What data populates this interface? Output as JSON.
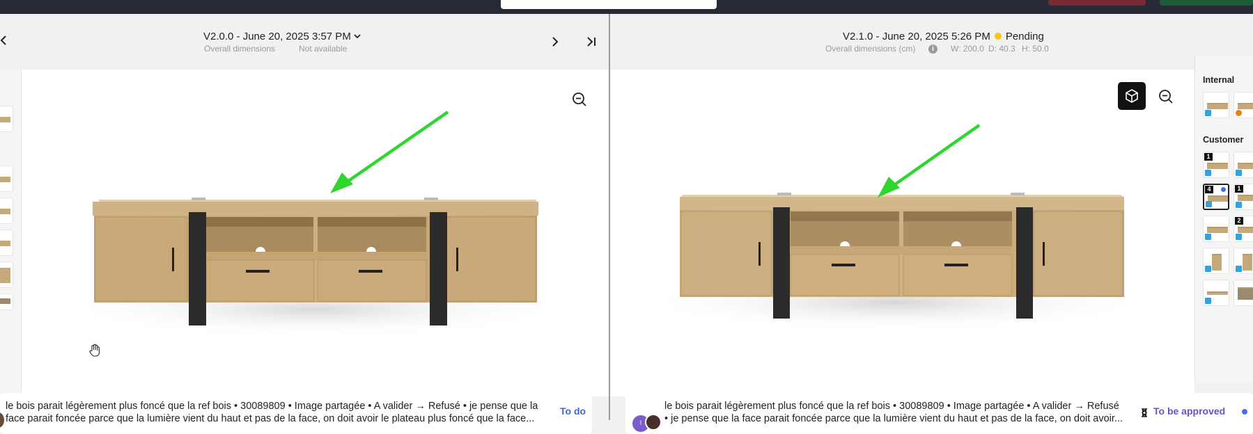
{
  "left_version": {
    "title": "V2.0.0 - June 20, 2025 3:57 PM",
    "dims_label": "Overall dimensions",
    "dims_value": "Not available"
  },
  "right_version": {
    "title": "V2.1.0 - June 20, 2025 5:26 PM",
    "status": "Pending",
    "status_color": "#f5c518",
    "dims_label": "Overall dimensions (cm)",
    "width": "W: 200.0",
    "depth": "D: 40.3",
    "height": "H: 50.0"
  },
  "sidebar": {
    "internal_label": "Internal",
    "customer_label": "Customer",
    "badges": [
      "1",
      "4",
      "1",
      "2"
    ]
  },
  "left_comment": {
    "line1": "le bois parait légèrement plus foncé que la ref bois • 30089809 • Image partagée • A valider → Refusé • je pense que la",
    "line2": "face parait foncée parce que la lumière vient du haut et pas de la face, on doit avoir le plateau plus foncé que la face...",
    "status": "To do",
    "status_color": "#3f64e0"
  },
  "right_comment": {
    "avatar_initial": "I",
    "line1": "le bois parait légèrement plus foncé que la ref bois • 30089809 • Image partagée • A valider → Refusé",
    "line2": "• je pense que la face parait foncée parce que la lumière vient du haut et pas de la face, on doit avoir...",
    "status": "To be approved",
    "status_color": "#6a4fd0"
  },
  "colors": {
    "arrow": "#2fd62f",
    "wood": "#c9a97a",
    "metal": "#2b2b2b"
  }
}
